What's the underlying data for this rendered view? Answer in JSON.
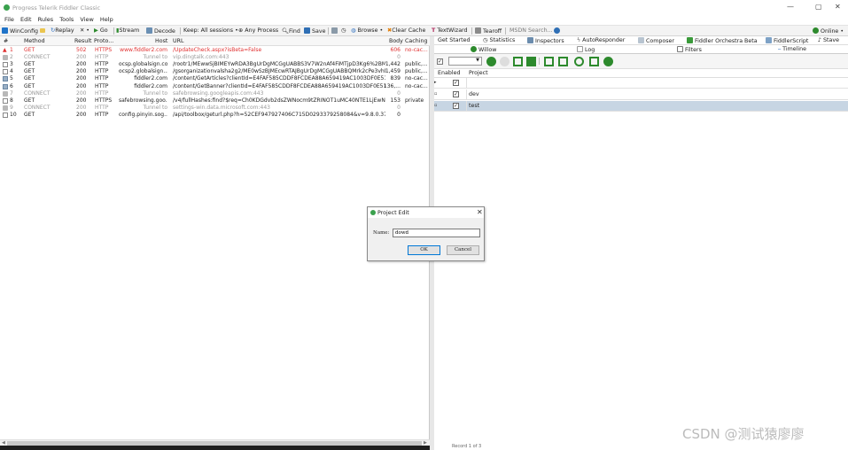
{
  "window": {
    "title": "Progress Telerik Fiddler Classic",
    "controls": [
      "—",
      "▢",
      "✕"
    ]
  },
  "menu": [
    "File",
    "Edit",
    "Rules",
    "Tools",
    "View",
    "Help"
  ],
  "toolbar": {
    "winconfig": "WinConfig",
    "replay": "Replay",
    "remove": "✕ •",
    "go": "Go",
    "stream": "Stream",
    "decode": "Decode",
    "keep": "Keep: All sessions •",
    "any_process": "Any Process",
    "find": "Find",
    "save": "Save",
    "browse": "Browse •",
    "clear_cache": "Clear Cache",
    "textwizard": "TextWizard",
    "tearoff": "Tearoff",
    "msdn_search": "MSDN Search...",
    "online": "Online •",
    "icon_colors": {
      "winconfig": "#1f73c8",
      "stream": "#2d8a2d",
      "find": "#555555",
      "save": "#2f6fb5",
      "online": "#2d8a2d"
    }
  },
  "sessions": {
    "columns": [
      "#",
      "Method",
      "Result",
      "Proto...",
      "Host",
      "URL",
      "Body",
      "Caching"
    ],
    "rows": [
      {
        "num": "1",
        "method": "GET",
        "result": "502",
        "proto": "HTTPS",
        "host": "www.fiddler2.com",
        "url": "/UpdateCheck.aspx?isBeta=False",
        "body": "606",
        "caching": "no-cac...",
        "style": "red",
        "icon": "warning-icon"
      },
      {
        "num": "2",
        "method": "CONNECT",
        "result": "200",
        "proto": "HTTP",
        "host": "Tunnel to",
        "url": "vip.dingtalk.com:443",
        "body": "0",
        "caching": "",
        "style": "grey",
        "icon": "lock-icon"
      },
      {
        "num": "3",
        "method": "GET",
        "result": "200",
        "proto": "HTTP",
        "host": "ocsp.globalsign.com",
        "url": "/rootr1/MEwwSjBIMEYwRDA3BgUrDgMCGgUABBS3V7W2nAf4FiMTjpD3Kg6%2BMg...",
        "body": "1,442",
        "caching": "public,...",
        "style": "normal",
        "icon": "doc-icon"
      },
      {
        "num": "4",
        "method": "GET",
        "result": "200",
        "proto": "HTTP",
        "host": "ocsp2.globalsign....",
        "url": "/gsorganizationvalsha2g2/ME0wSzBJMEcwRTAJBgUrDgMCGgUABBQMrk2cPe3vhN...",
        "body": "1,459",
        "caching": "public,...",
        "style": "normal",
        "icon": "doc-icon"
      },
      {
        "num": "5",
        "method": "GET",
        "result": "200",
        "proto": "HTTP",
        "host": "fiddler2.com",
        "url": "/content/GetArticles?clientId=E4FAF585CDDF8FCDEA88A659419AC1003DF0E51...",
        "body": "839",
        "caching": "no-cac...",
        "style": "normal",
        "icon": "script-icon"
      },
      {
        "num": "6",
        "method": "GET",
        "result": "200",
        "proto": "HTTP",
        "host": "fiddler2.com",
        "url": "/content/GetBanner?clientId=E4FAF585CDDF8FCDEA88A659419AC1003DF0E51...",
        "body": "136,...",
        "caching": "no-cac...",
        "style": "normal",
        "icon": "script-icon"
      },
      {
        "num": "7",
        "method": "CONNECT",
        "result": "200",
        "proto": "HTTP",
        "host": "Tunnel to",
        "url": "safebrowsing.googleapis.com:443",
        "body": "0",
        "caching": "",
        "style": "grey",
        "icon": "lock-icon"
      },
      {
        "num": "8",
        "method": "GET",
        "result": "200",
        "proto": "HTTPS",
        "host": "safebrowsing.goo...",
        "url": "/v4/fullHashes:find?$req=Ch0KDGdvb2dsZWNocm9tZRINOT1uMC40NTE1LjEwNxIb...",
        "body": "153",
        "caching": "private",
        "style": "normal",
        "icon": "doc-icon"
      },
      {
        "num": "9",
        "method": "CONNECT",
        "result": "200",
        "proto": "HTTP",
        "host": "Tunnel to",
        "url": "settings-win.data.microsoft.com:443",
        "body": "0",
        "caching": "",
        "style": "grey",
        "icon": "lock-icon"
      },
      {
        "num": "10",
        "method": "GET",
        "result": "200",
        "proto": "HTTP",
        "host": "config.pinyin.sog...",
        "url": "/api/toolbox/geturl.php?h=52CEF947927406C715D0293379258084&v=9.8.0.37...",
        "body": "0",
        "caching": "",
        "style": "normal",
        "icon": "doc-icon"
      }
    ]
  },
  "right_tabs_row1": [
    "Get Started",
    "Statistics",
    "Inspectors",
    "AutoResponder",
    "Composer",
    "Fiddler Orchestra Beta",
    "FiddlerScript",
    "Stave"
  ],
  "right_tabs_row2": [
    "Willow",
    "Log",
    "Filters",
    "Timeline"
  ],
  "willow_grid": {
    "columns": [
      "Enabled",
      "Project"
    ],
    "rows": [
      {
        "enabled": true,
        "project": "",
        "current": true,
        "selected": false
      },
      {
        "enabled": true,
        "project": "dev",
        "current": false,
        "selected": false
      },
      {
        "enabled": true,
        "project": "test",
        "current": false,
        "selected": true
      }
    ],
    "footer": "Record 1 of 3"
  },
  "dialog": {
    "title": "Project Edit",
    "name_label": "Name:",
    "name_value": "dowd",
    "ok_label": "OK",
    "cancel_label": "Cancel"
  },
  "watermark": "CSDN @测试猿廖廖"
}
